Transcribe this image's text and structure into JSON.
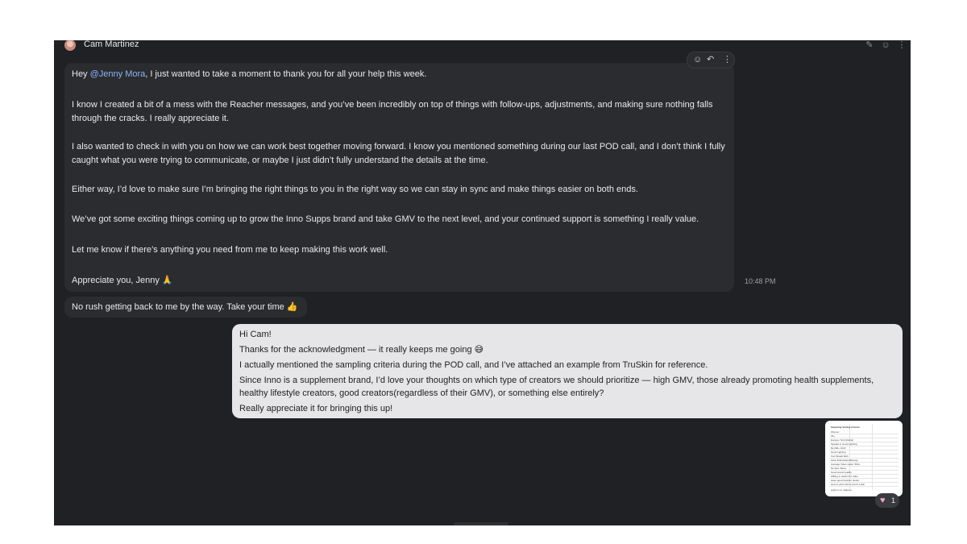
{
  "header": {
    "contact_name": "Cam Martinez",
    "icons": [
      "edit-icon",
      "emoji-icon",
      "more-vert-icon"
    ]
  },
  "message_actions": {
    "icons": [
      "emoji-react-icon",
      "reply-icon",
      "more-vert-icon"
    ]
  },
  "incoming_message": {
    "greeting_prefix": "Hey ",
    "mention": "@Jenny Mora",
    "greeting_rest": ", I just wanted to take a moment to thank you for all your help this week.",
    "p2": "I know I created a bit of a mess with the Reacher messages, and you’ve been incredibly on top of things with follow-ups, adjustments, and making sure nothing falls through the cracks. I really appreciate it.",
    "p3": "I also wanted to check in with you on how we can work best together moving forward. I know you mentioned something during our last POD call, and I don’t think I fully caught what you were trying to communicate, or maybe I just didn’t fully understand the details at the time.",
    "p4": "Either way, I’d love to make sure I’m bringing the right things to you in the right way so we can stay in sync and make things easier on both ends.",
    "p5": "We’ve got some exciting things coming up to grow the Inno Supps brand and take GMV to the next level, and your continued support is something I really value.",
    "p6": "Let me know if there’s anything you need from me to keep making this work well.",
    "p7": "Appreciate you, Jenny 🙏",
    "time": "10:48 PM"
  },
  "followup_message": {
    "text": "No rush getting back to me by the way. Take your time 👍"
  },
  "outgoing_message": {
    "l1": "Hi Cam!",
    "l2": "Thanks for the acknowledgment — it really keeps me going 😅",
    "l3": "I actually mentioned the sampling criteria during the POD call, and I’ve attached an example from TruSkin for reference.",
    "l4": "Since Inno is a supplement brand, I’d love your thoughts on which type of creators we should prioritize — high GMV, those already promoting health supplements,",
    "l5": "healthy lifestyle creators, good creators(regardless of their GMV), or something else entirely?",
    "l6": "Really appreciate it for bringing this up!"
  },
  "attachment": {
    "title": "Sampling Vetting Criteria",
    "rows": [
      "Women",
      "18+",
      "Europe / Sub (Rebel)",
      "Speaks in Good Lighting",
      "$1,000+ GMV",
      "Good Lighting",
      "Can Speak Well",
      "Have Enthusiasm/Energy",
      "Average Video views: 500+",
      "No face Tattoo",
      "Good sound quality",
      "Willing to watch her video",
      "Have good hook/on hooks",
      "How to pitch with a Cat & a skin"
    ],
    "footer": "Light to no makeup"
  },
  "reaction": {
    "emoji_icon": "heart-icon",
    "count": "1",
    "color": "#f3a6c8"
  }
}
